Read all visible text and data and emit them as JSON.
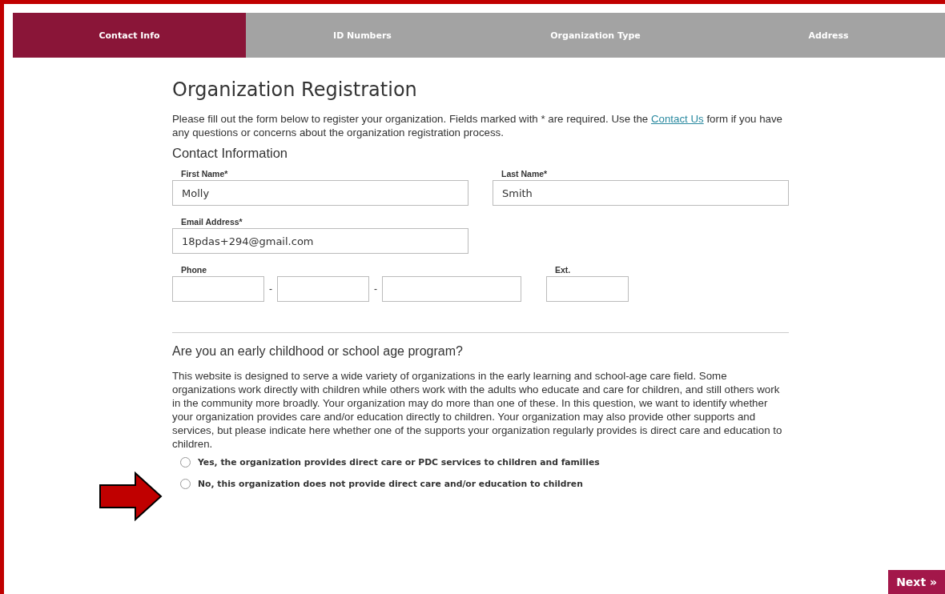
{
  "tabs": [
    {
      "label": "Contact Info",
      "selected": true
    },
    {
      "label": "ID Numbers",
      "selected": false
    },
    {
      "label": "Organization Type",
      "selected": false
    },
    {
      "label": "Address",
      "selected": false
    }
  ],
  "title": "Organization Registration",
  "intro": {
    "before": "Please fill out the form below to register your organization. Fields marked with * are required. Use the ",
    "link": "Contact Us",
    "after": " form if you have any questions or concerns about the organization registration process."
  },
  "section_title": "Contact Information",
  "fields": {
    "first_name": {
      "label": "First Name*",
      "value": "Molly"
    },
    "last_name": {
      "label": "Last Name*",
      "value": "Smith"
    },
    "email": {
      "label": "Email Address*",
      "value": "18pdas+294@gmail.com"
    }
  },
  "phone": {
    "label": "Phone",
    "separators": [
      "-",
      "-"
    ],
    "ext_label": "Ext."
  },
  "question": {
    "title": "Are you an early childhood or school age program?",
    "text": "This website is designed to serve a wide variety of organizations in the early learning and school-age care field. Some organizations work directly with children while others work with the adults who educate and care for children, and still others work in the community more broadly. Your organization may do more than one of these. In this question, we want to identify whether your organization provides care and/or education directly to children. Your organization may also provide other supports and services, but please indicate here whether one of the supports your organization regularly provides is direct care and education to children.",
    "options": [
      {
        "label": "Yes, the organization provides direct care or PDC services to children and families",
        "selected": false
      },
      {
        "label": "No, this organization does not provide direct care and/or education to children",
        "selected": false
      }
    ]
  },
  "next_button": "Next »"
}
